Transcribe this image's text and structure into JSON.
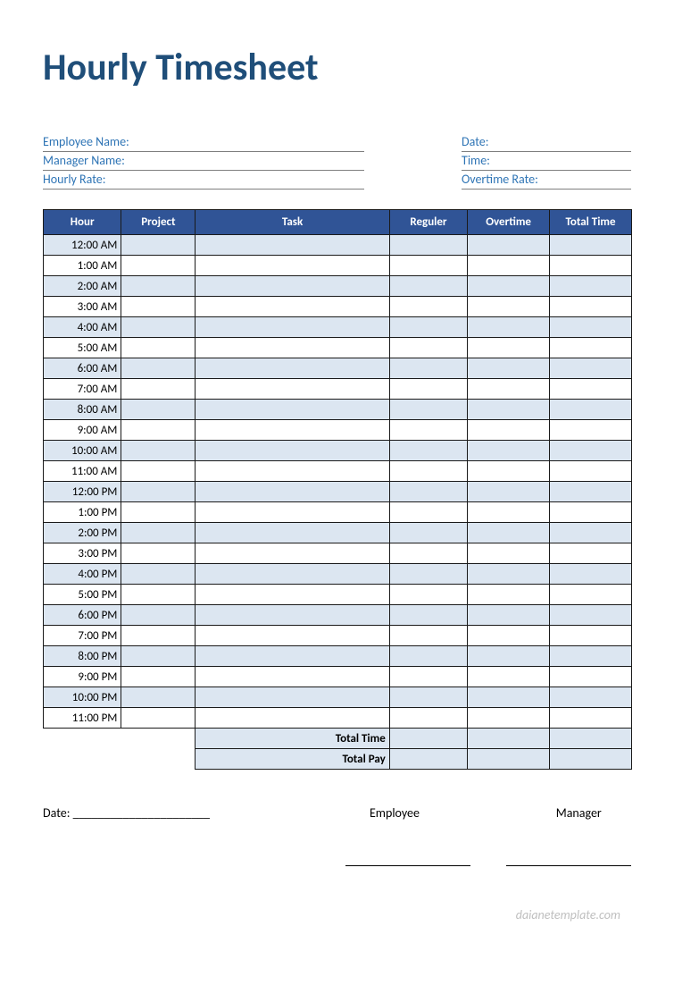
{
  "title": "Hourly Timesheet",
  "info_left": {
    "employee_name_label": "Employee Name:",
    "manager_name_label": "Manager Name:",
    "hourly_rate_label": "Hourly Rate:"
  },
  "info_right": {
    "date_label": "Date:",
    "time_label": "Time:",
    "overtime_rate_label": "Overtime Rate:"
  },
  "table": {
    "headers": {
      "hour": "Hour",
      "project": "Project",
      "task": "Task",
      "reguler": "Reguler",
      "overtime": "Overtime",
      "total_time": "Total Time"
    },
    "hours": [
      "12:00 AM",
      "1:00 AM",
      "2:00 AM",
      "3:00 AM",
      "4:00 AM",
      "5:00 AM",
      "6:00 AM",
      "7:00 AM",
      "8:00 AM",
      "9:00 AM",
      "10:00 AM",
      "11:00 AM",
      "12:00 PM",
      "1:00 PM",
      "2:00 PM",
      "3:00 PM",
      "4:00 PM",
      "5:00 PM",
      "6:00 PM",
      "7:00 PM",
      "8:00 PM",
      "9:00 PM",
      "10:00 PM",
      "11:00 PM"
    ],
    "summary": {
      "total_time_label": "Total Time",
      "total_pay_label": "Total Pay"
    }
  },
  "signature": {
    "date_label": "Date: ______________________",
    "employee_label": "Employee",
    "manager_label": "Manager"
  },
  "footer_text": "daianetemplate.com",
  "chart_data": {
    "type": "table",
    "title": "Hourly Timesheet",
    "columns": [
      "Hour",
      "Project",
      "Task",
      "Reguler",
      "Overtime",
      "Total Time"
    ],
    "rows": [
      [
        "12:00 AM",
        "",
        "",
        "",
        "",
        ""
      ],
      [
        "1:00 AM",
        "",
        "",
        "",
        "",
        ""
      ],
      [
        "2:00 AM",
        "",
        "",
        "",
        "",
        ""
      ],
      [
        "3:00 AM",
        "",
        "",
        "",
        "",
        ""
      ],
      [
        "4:00 AM",
        "",
        "",
        "",
        "",
        ""
      ],
      [
        "5:00 AM",
        "",
        "",
        "",
        "",
        ""
      ],
      [
        "6:00 AM",
        "",
        "",
        "",
        "",
        ""
      ],
      [
        "7:00 AM",
        "",
        "",
        "",
        "",
        ""
      ],
      [
        "8:00 AM",
        "",
        "",
        "",
        "",
        ""
      ],
      [
        "9:00 AM",
        "",
        "",
        "",
        "",
        ""
      ],
      [
        "10:00 AM",
        "",
        "",
        "",
        "",
        ""
      ],
      [
        "11:00 AM",
        "",
        "",
        "",
        "",
        ""
      ],
      [
        "12:00 PM",
        "",
        "",
        "",
        "",
        ""
      ],
      [
        "1:00 PM",
        "",
        "",
        "",
        "",
        ""
      ],
      [
        "2:00 PM",
        "",
        "",
        "",
        "",
        ""
      ],
      [
        "3:00 PM",
        "",
        "",
        "",
        "",
        ""
      ],
      [
        "4:00 PM",
        "",
        "",
        "",
        "",
        ""
      ],
      [
        "5:00 PM",
        "",
        "",
        "",
        "",
        ""
      ],
      [
        "6:00 PM",
        "",
        "",
        "",
        "",
        ""
      ],
      [
        "7:00 PM",
        "",
        "",
        "",
        "",
        ""
      ],
      [
        "8:00 PM",
        "",
        "",
        "",
        "",
        ""
      ],
      [
        "9:00 PM",
        "",
        "",
        "",
        "",
        ""
      ],
      [
        "10:00 PM",
        "",
        "",
        "",
        "",
        ""
      ],
      [
        "11:00 PM",
        "",
        "",
        "",
        "",
        ""
      ]
    ],
    "summary_rows": [
      [
        "",
        "",
        "Total Time",
        "",
        "",
        ""
      ],
      [
        "",
        "",
        "Total Pay",
        "",
        "",
        ""
      ]
    ]
  }
}
